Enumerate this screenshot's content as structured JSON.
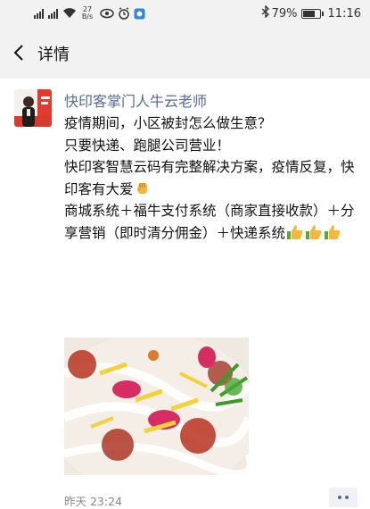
{
  "status_bar": {
    "net_speed_value": "27",
    "net_speed_unit": "B/s",
    "battery_percent": "79%",
    "battery_level": 0.79,
    "time": "11:16"
  },
  "nav": {
    "title": "详情"
  },
  "post": {
    "author": "快印客掌门人牛云老师",
    "lines": [
      "疫情期间，小区被封怎么做生意？",
      "只要快递、跑腿公司营业！",
      "快印客智慧云码有完整解决方案，疫情反复，快印客有大爱",
      "商城系统＋福牛支付系统（商家直接收款）＋分享营销（即时清分佣金）＋快递系统"
    ],
    "timestamp": "昨天 23:24"
  },
  "icons": {
    "back": "back-arrow-icon",
    "fist": "raised-fist-emoji",
    "thumbs": "thumbs-up-emoji",
    "more": "more-dots-icon"
  },
  "colors": {
    "author_link": "#576b95",
    "bar_bg": "#f2f2f2",
    "timestamp": "#888888"
  }
}
